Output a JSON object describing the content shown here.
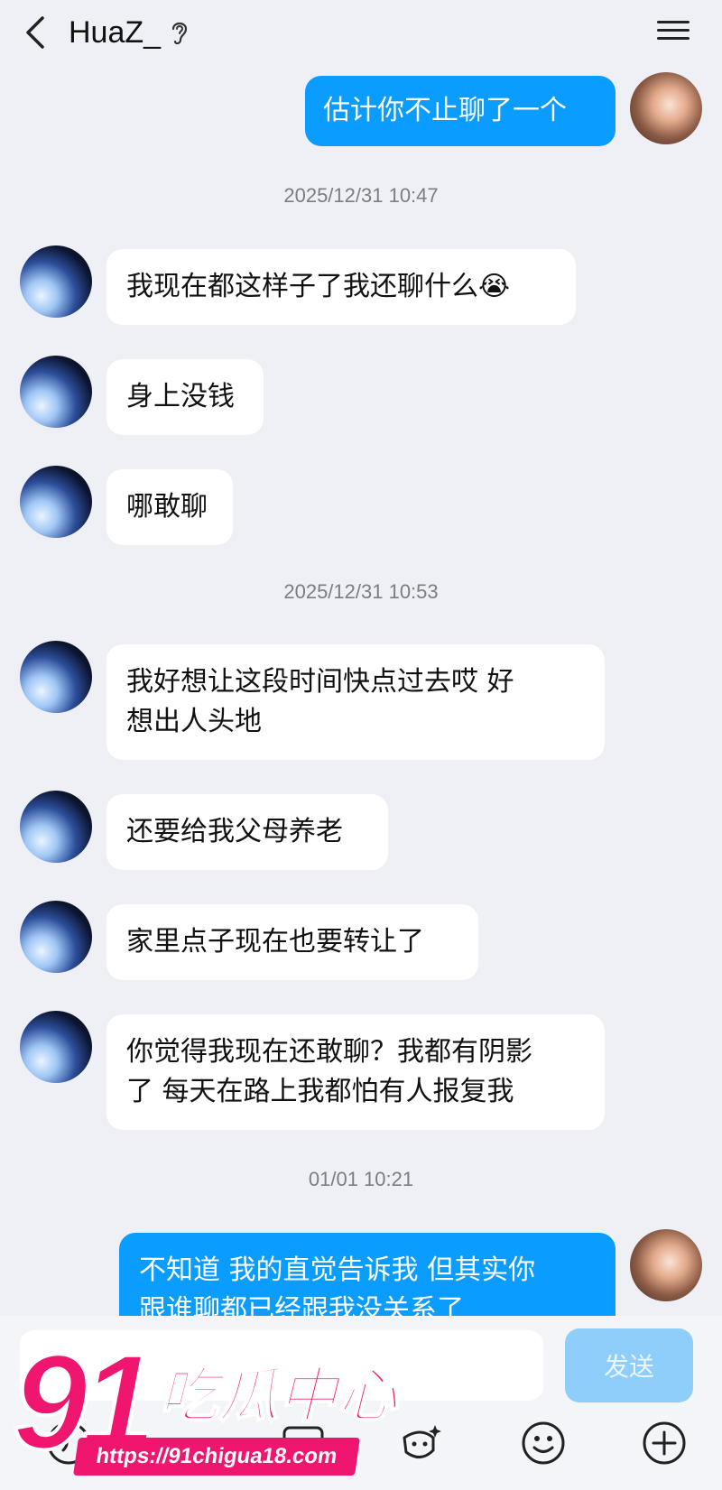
{
  "header": {
    "title": "HuaZ_"
  },
  "messages": [
    {
      "side": "out",
      "text": "估计你不止聊了一个"
    },
    {
      "timestamp": "2025/12/31 10:47"
    },
    {
      "side": "in",
      "text": "我现在都这样子了我还聊什么😭"
    },
    {
      "side": "in",
      "text": "身上没钱"
    },
    {
      "side": "in",
      "text": "哪敢聊"
    },
    {
      "timestamp": "2025/12/31 10:53"
    },
    {
      "side": "in",
      "line1": "我好想让这段时间快点过去哎 好",
      "line2": "想出人头地"
    },
    {
      "side": "in",
      "text": "还要给我父母养老"
    },
    {
      "side": "in",
      "text": "家里点子现在也要转让了"
    },
    {
      "side": "in",
      "line1": "你觉得我现在还敢聊？我都有阴影",
      "line2": "了 每天在路上我都怕有人报复我"
    },
    {
      "timestamp": "01/01 10:21"
    },
    {
      "side": "out",
      "line1": "不知道 我的直觉告诉我 但其实你",
      "line2": "跟谁聊都已经跟我没关系了"
    }
  ],
  "composer": {
    "send_label": "发送",
    "input_value": ""
  },
  "toolbar_icons": [
    "voice-icon",
    "image-icon",
    "sparkle-face-icon",
    "emoji-icon",
    "plus-icon"
  ],
  "watermark": {
    "number": "91",
    "text": "吃瓜中心",
    "url": "https://91chigua18.com"
  },
  "colors": {
    "background": "#eef0f5",
    "outgoing_bubble": "#0a9cff",
    "incoming_bubble": "#ffffff",
    "send_button": "#8fcdfb",
    "watermark": "#f0156e"
  }
}
